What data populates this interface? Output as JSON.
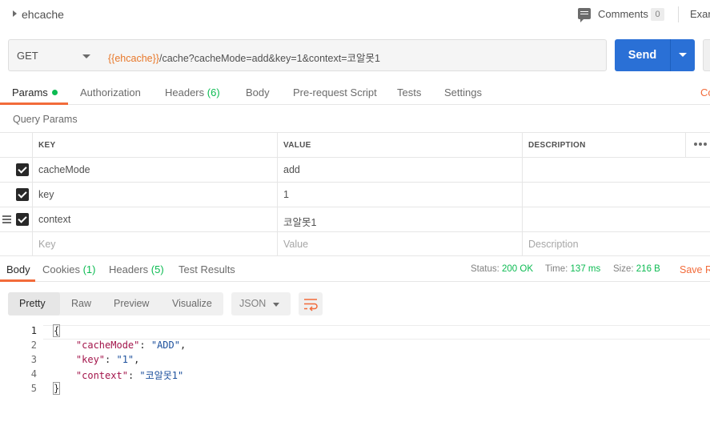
{
  "request": {
    "name": "ehcache",
    "method": "GET",
    "url_var": "{{ehcache}}",
    "url_path": "/cache?cacheMode=add&key=1&context=코알못1",
    "send_label": "Send"
  },
  "topbar": {
    "comments_label": "Comments",
    "comments_count": "0",
    "examples_label": "Exar"
  },
  "req_tabs": {
    "params": "Params",
    "authorization": "Authorization",
    "headers": "Headers",
    "headers_count": "(6)",
    "body": "Body",
    "prerequest": "Pre-request Script",
    "tests": "Tests",
    "settings": "Settings",
    "cookies_partial": "Co"
  },
  "query_params": {
    "title": "Query Params",
    "headers": [
      "KEY",
      "VALUE",
      "DESCRIPTION"
    ],
    "rows": [
      {
        "key": "cacheMode",
        "value": "add",
        "description": "",
        "checked": true
      },
      {
        "key": "key",
        "value": "1",
        "description": "",
        "checked": true
      },
      {
        "key": "context",
        "value": "코알못1",
        "description": "",
        "checked": true
      }
    ],
    "placeholder": {
      "key": "Key",
      "value": "Value",
      "description": "Description"
    }
  },
  "response": {
    "tabs": {
      "body": "Body",
      "cookies": "Cookies",
      "cookies_count": "(1)",
      "headers": "Headers",
      "headers_count": "(5)",
      "test_results": "Test Results"
    },
    "status_label": "Status:",
    "status_value": "200 OK",
    "time_label": "Time:",
    "time_value": "137 ms",
    "size_label": "Size:",
    "size_value": "216 B",
    "save_partial": "Save R"
  },
  "viewer": {
    "modes": [
      "Pretty",
      "Raw",
      "Preview",
      "Visualize"
    ],
    "active_mode": "Pretty",
    "format": "JSON",
    "wrap_icon": "wrap-lines-icon"
  },
  "code": {
    "line_numbers": [
      "1",
      "2",
      "3",
      "4",
      "5"
    ],
    "open_brace": "{",
    "close_brace": "}",
    "entries": [
      {
        "key": "\"cacheMode\"",
        "value": "\"ADD\"",
        "comma": ","
      },
      {
        "key": "\"key\"",
        "value": "\"1\"",
        "comma": ","
      },
      {
        "key": "\"context\"",
        "value": "\"코알못1\"",
        "comma": ""
      }
    ]
  },
  "colors": {
    "accent": "#f26b3a",
    "send_button": "#2a70d6",
    "success": "#0cbb52",
    "url_variable": "#e8782a"
  }
}
